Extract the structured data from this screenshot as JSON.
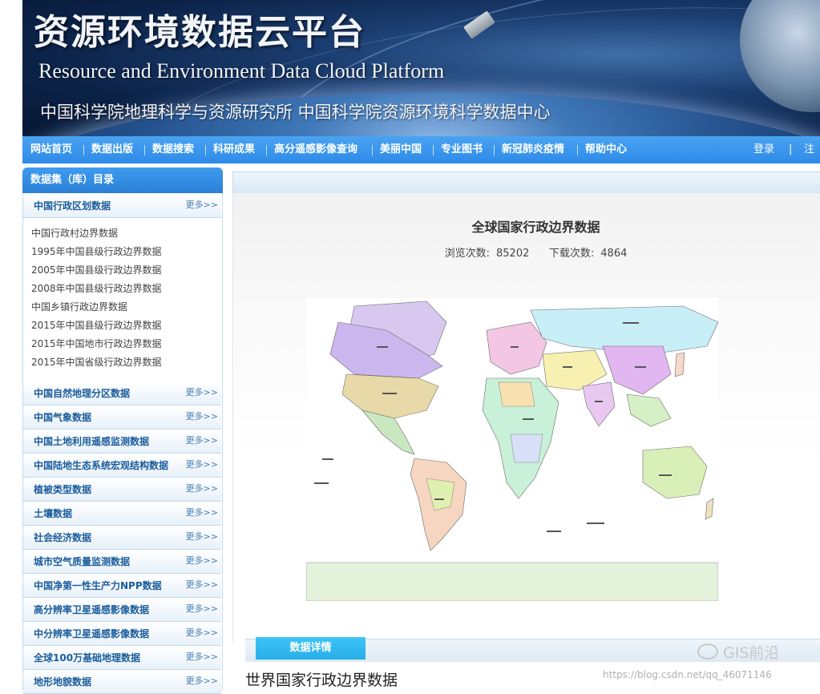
{
  "banner": {
    "zh_title": "资源环境数据云平台",
    "en_title": "Resource and Environment Data Cloud Platform",
    "zh_subtitle": "中国科学院地理科学与资源研究所  中国科学院资源环境科学数据中心"
  },
  "nav": {
    "items": [
      "网站首页",
      "数据出版",
      "数据搜索",
      "科研成果",
      "高分遥感影像查询",
      "美丽中国",
      "专业图书",
      "新冠肺炎疫情",
      "帮助中心"
    ],
    "login": "登录",
    "divider": "|",
    "register": "注册"
  },
  "sidebar": {
    "header": "数据集（库）目录",
    "more_label": "更多>>",
    "expanded_category": "中国行政区划数据",
    "sub_items": [
      "中国行政村边界数据",
      "1995年中国县级行政边界数据",
      "2005年中国县级行政边界数据",
      "2008年中国县级行政边界数据",
      "中国乡镇行政边界数据",
      "2015年中国县级行政边界数据",
      "2015年中国地市行政边界数据",
      "2015年中国省级行政边界数据"
    ],
    "categories": [
      "中国自然地理分区数据",
      "中国气象数据",
      "中国土地利用遥感监测数据",
      "中国陆地生态系统宏观结构数据",
      "植被类型数据",
      "土壤数据",
      "社会经济数据",
      "城市空气质量监测数据",
      "中国净第一性生产力NPP数据",
      "高分辨率卫星遥感影像数据",
      "中分辨率卫星遥感影像数据",
      "全球100万基础地理数据",
      "地形地貌数据"
    ]
  },
  "dataset": {
    "title": "全球国家行政边界数据",
    "views_label": "浏览次数:",
    "views": "85202",
    "downloads_label": "下载次数:",
    "downloads": "4864",
    "detail_tab": "数据详情",
    "detail_heading": "世界国家行政边界数据"
  },
  "watermark": {
    "brand": "GIS前沿",
    "url": "https://blog.csdn.net/qq_46071146"
  },
  "colors": {
    "nav_blue": "#2d8ae8",
    "sidebar_header": "#2a7fd6",
    "category_text": "#1b5c9b",
    "detail_tab": "#27aee8"
  }
}
